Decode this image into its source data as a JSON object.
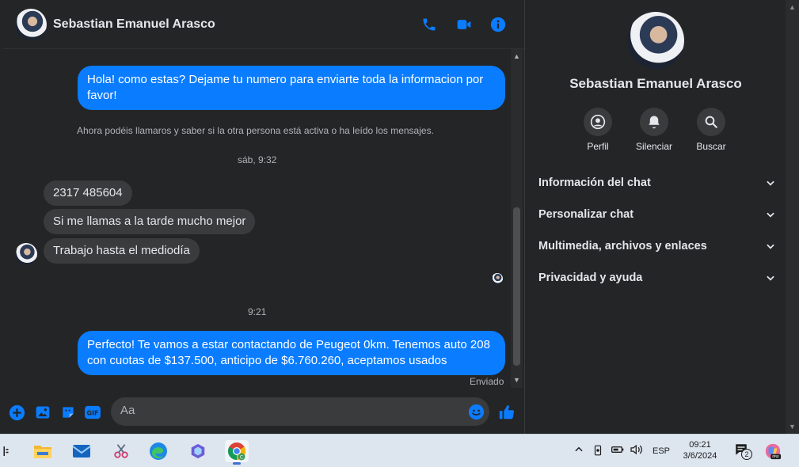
{
  "header": {
    "name": "Sebastian Emanuel Arasco"
  },
  "messages": {
    "out1": "Hola! como estas? Dejame tu numero para enviarte toda la informacion por favor!",
    "system": "Ahora podéis llamaros y saber si la otra persona está activa o ha leído los mensajes.",
    "stamp1": "sáb, 9:32",
    "in1": "2317 485604",
    "in2": "Si me llamas a la tarde mucho mejor",
    "in3": "Trabajo hasta el mediodía",
    "stamp2": "9:21",
    "out2": "Perfecto! Te vamos a estar contactando de Peugeot 0km. Tenemos auto 208 con cuotas de $137.500, anticipo de $6.760.260, aceptamos usados",
    "status": "Enviado"
  },
  "composer": {
    "placeholder": "Aa"
  },
  "side": {
    "name": "Sebastian Emanuel Arasco",
    "actions": [
      {
        "label": "Perfil",
        "icon": "profile-icon"
      },
      {
        "label": "Silenciar",
        "icon": "bell-icon"
      },
      {
        "label": "Buscar",
        "icon": "search-icon"
      }
    ],
    "sections": [
      "Información del chat",
      "Personalizar chat",
      "Multimedia, archivos y enlaces",
      "Privacidad y ayuda"
    ]
  },
  "taskbar": {
    "language": "ESP",
    "time": "09:21",
    "date": "3/6/2024",
    "notif_count": "2"
  },
  "colors": {
    "accent": "#0a7cff",
    "background": "#242526",
    "incoming_bubble": "#3a3b3c",
    "icon_blue": "#0a7cff"
  }
}
